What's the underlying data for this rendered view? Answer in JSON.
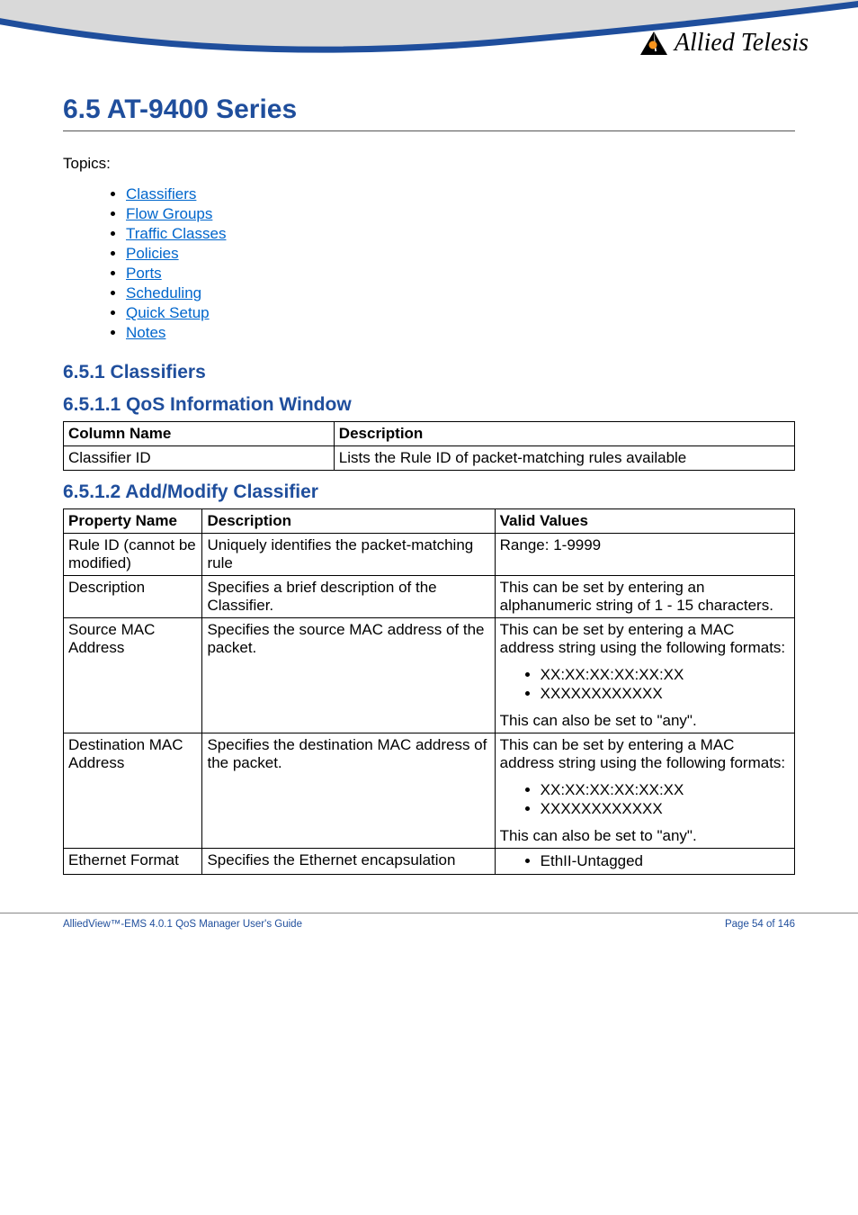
{
  "logo": {
    "brand": "Allied Telesis"
  },
  "section": {
    "title": "6.5 AT-9400 Series",
    "topics_label": "Topics:",
    "topics": [
      "Classifiers",
      "Flow Groups",
      "Traffic Classes",
      "Policies",
      "Ports",
      "Scheduling",
      "Quick Setup",
      "Notes"
    ]
  },
  "classifiers": {
    "heading": "6.5.1 Classifiers",
    "qos_window": {
      "heading": "6.5.1.1 QoS Information Window",
      "headers": {
        "col1": "Column Name",
        "col2": "Description"
      },
      "row": {
        "name": "Classifier ID",
        "desc": "Lists the Rule ID of packet-matching rules available"
      }
    },
    "add_modify": {
      "heading": "6.5.1.2 Add/Modify Classifier",
      "headers": {
        "col1": "Property Name",
        "col2": "Description",
        "col3": "Valid Values"
      },
      "rows": {
        "rule_id": {
          "name": "Rule ID (cannot be modified)",
          "desc": "Uniquely identifies the packet-matching rule",
          "valid": "Range: 1-9999"
        },
        "description": {
          "name": "Description",
          "desc": "Specifies a brief description of the Classifier.",
          "valid": "This can be set by entering an alphanumeric string of 1 - 15 characters."
        },
        "source_mac": {
          "name": "Source MAC Address",
          "desc": "Specifies the source MAC address of the packet.",
          "valid_intro": "This can be set by entering a MAC address string using the following formats:",
          "valid_b1": "XX:XX:XX:XX:XX:XX",
          "valid_b2": "XXXXXXXXXXXX",
          "valid_outro": "This can also be set to \"any\"."
        },
        "dest_mac": {
          "name": "Destination MAC Address",
          "desc": "Specifies the destination MAC address of the packet.",
          "valid_intro": "This can be set by entering a MAC address string using the following formats:",
          "valid_b1": "XX:XX:XX:XX:XX:XX",
          "valid_b2": "XXXXXXXXXXXX",
          "valid_outro": "This can also be set to \"any\"."
        },
        "ethernet_format": {
          "name": "Ethernet Format",
          "desc": "Specifies the Ethernet encapsulation",
          "valid_b1": "EthII-Untagged"
        }
      }
    }
  },
  "footer": {
    "left": "AlliedView™-EMS 4.0.1 QoS Manager User's Guide",
    "right": "Page 54 of 146"
  }
}
